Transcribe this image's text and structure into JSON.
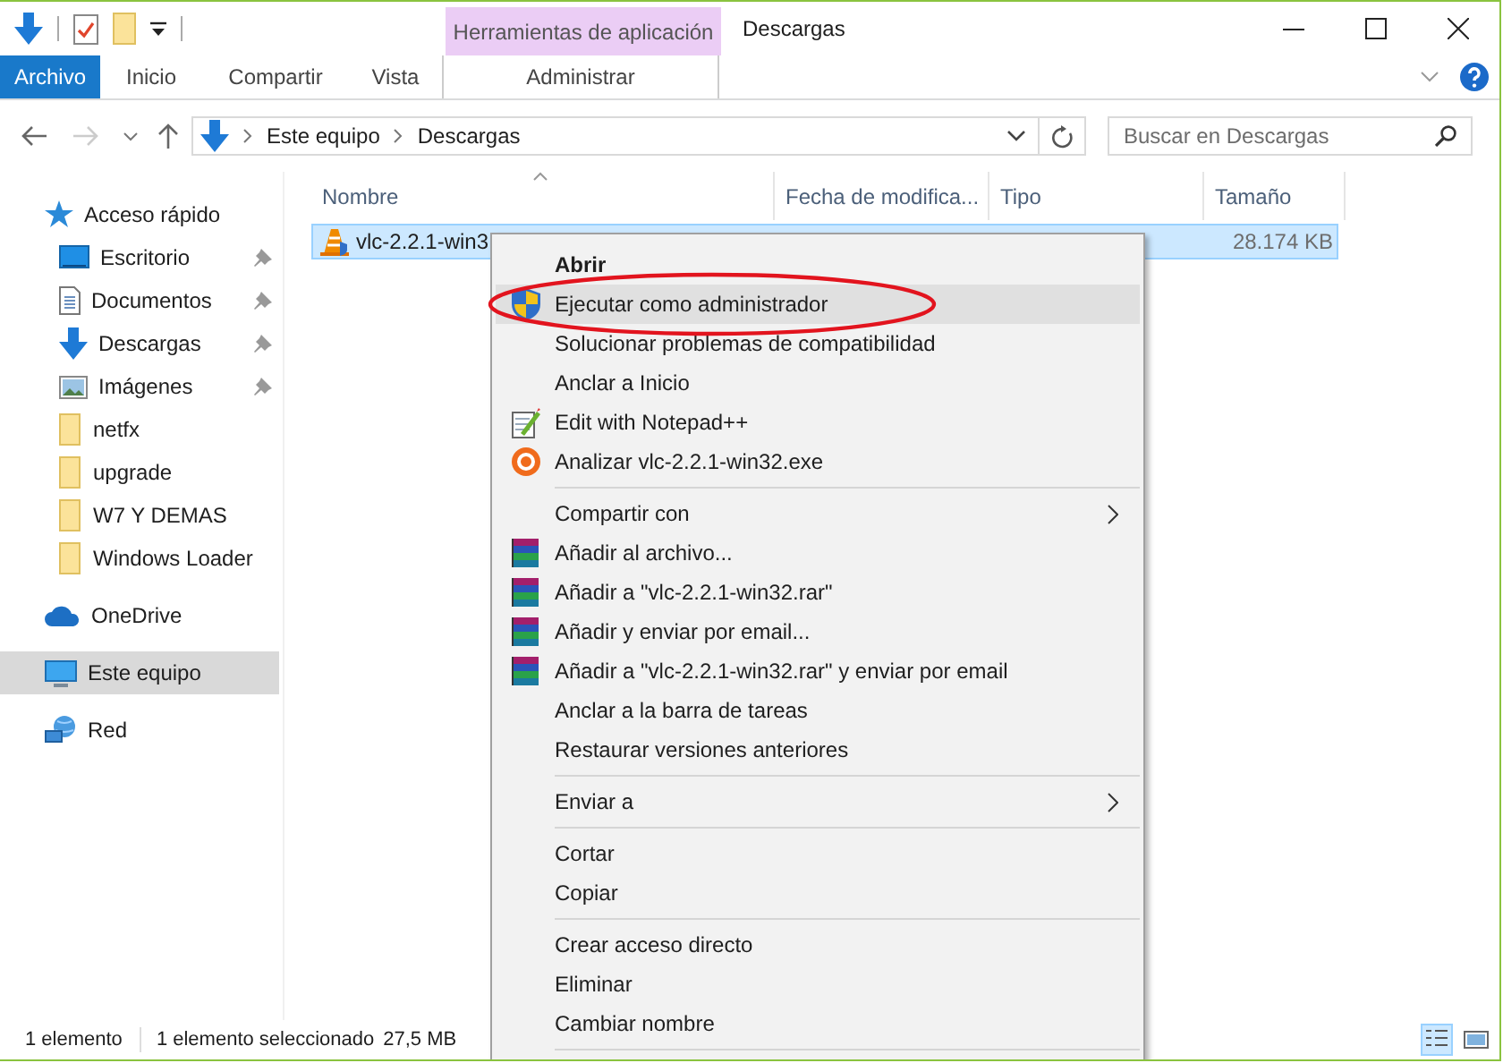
{
  "window": {
    "title": "Descargas",
    "context_tab_group": "Herramientas de aplicación"
  },
  "ribbon_tabs": [
    {
      "label": "Archivo",
      "kind": "file"
    },
    {
      "label": "Inicio",
      "kind": "tab"
    },
    {
      "label": "Compartir",
      "kind": "tab"
    },
    {
      "label": "Vista",
      "kind": "tab"
    },
    {
      "label": "Administrar",
      "kind": "context"
    }
  ],
  "address_bar": {
    "path": [
      "Este equipo",
      "Descargas"
    ]
  },
  "search": {
    "placeholder": "Buscar en Descargas"
  },
  "navigation": [
    {
      "label": "Acceso rápido",
      "kind": "star",
      "selected": false,
      "children": [
        {
          "label": "Escritorio",
          "kind": "desktop",
          "pinned": true,
          "selected": false
        },
        {
          "label": "Documentos",
          "kind": "documents",
          "pinned": true,
          "selected": false
        },
        {
          "label": "Descargas",
          "kind": "downloads",
          "pinned": true,
          "selected": false
        },
        {
          "label": "Imágenes",
          "kind": "pictures",
          "pinned": true,
          "selected": false
        },
        {
          "label": "netfx",
          "kind": "folder",
          "pinned": false,
          "selected": false
        },
        {
          "label": "upgrade",
          "kind": "folder",
          "pinned": false,
          "selected": false
        },
        {
          "label": "W7 Y DEMAS",
          "kind": "folder",
          "pinned": false,
          "selected": false
        },
        {
          "label": "Windows Loader",
          "kind": "folder",
          "pinned": false,
          "selected": false
        }
      ]
    },
    {
      "label": "OneDrive",
      "kind": "cloud",
      "selected": false
    },
    {
      "label": "Este equipo",
      "kind": "computer",
      "selected": true
    },
    {
      "label": "Red",
      "kind": "network",
      "selected": false
    }
  ],
  "columns": [
    {
      "label": "Nombre",
      "sorted": true
    },
    {
      "label": "Fecha de modifica...",
      "sorted": false
    },
    {
      "label": "Tipo",
      "sorted": false
    },
    {
      "label": "Tamaño",
      "sorted": false
    }
  ],
  "files": [
    {
      "name": "vlc-2.2.1-win3",
      "size": "28.174 KB",
      "selected": true
    }
  ],
  "context_menu": [
    {
      "kind": "plain",
      "label": "Abrir",
      "default": true,
      "hovered": false,
      "circled": false,
      "submenu": false
    },
    {
      "kind": "shield",
      "label": "Ejecutar como administrador",
      "default": false,
      "hovered": true,
      "circled": true,
      "submenu": false
    },
    {
      "kind": "plain",
      "label": "Solucionar problemas de compatibilidad",
      "default": false,
      "hovered": false,
      "circled": false,
      "submenu": false
    },
    {
      "kind": "plain",
      "label": "Anclar a Inicio",
      "default": false,
      "hovered": false,
      "circled": false,
      "submenu": false
    },
    {
      "kind": "notepad",
      "label": "Edit with Notepad++",
      "default": false,
      "hovered": false,
      "circled": false,
      "submenu": false
    },
    {
      "kind": "scan",
      "label": "Analizar vlc-2.2.1-win32.exe",
      "default": false,
      "hovered": false,
      "circled": false,
      "submenu": false
    },
    {
      "kind": "separator"
    },
    {
      "kind": "plain",
      "label": "Compartir con",
      "default": false,
      "hovered": false,
      "circled": false,
      "submenu": true
    },
    {
      "kind": "archive",
      "label": "Añadir al archivo...",
      "default": false,
      "hovered": false,
      "circled": false,
      "submenu": false
    },
    {
      "kind": "archive",
      "label": "Añadir a \"vlc-2.2.1-win32.rar\"",
      "default": false,
      "hovered": false,
      "circled": false,
      "submenu": false
    },
    {
      "kind": "archive",
      "label": "Añadir y enviar por email...",
      "default": false,
      "hovered": false,
      "circled": false,
      "submenu": false
    },
    {
      "kind": "archive",
      "label": "Añadir a \"vlc-2.2.1-win32.rar\" y enviar por email",
      "default": false,
      "hovered": false,
      "circled": false,
      "submenu": false
    },
    {
      "kind": "plain",
      "label": "Anclar a la barra de tareas",
      "default": false,
      "hovered": false,
      "circled": false,
      "submenu": false
    },
    {
      "kind": "plain",
      "label": "Restaurar versiones anteriores",
      "default": false,
      "hovered": false,
      "circled": false,
      "submenu": false
    },
    {
      "kind": "separator"
    },
    {
      "kind": "plain",
      "label": "Enviar a",
      "default": false,
      "hovered": false,
      "circled": false,
      "submenu": true
    },
    {
      "kind": "separator"
    },
    {
      "kind": "plain",
      "label": "Cortar",
      "default": false,
      "hovered": false,
      "circled": false,
      "submenu": false
    },
    {
      "kind": "plain",
      "label": "Copiar",
      "default": false,
      "hovered": false,
      "circled": false,
      "submenu": false
    },
    {
      "kind": "separator"
    },
    {
      "kind": "plain",
      "label": "Crear acceso directo",
      "default": false,
      "hovered": false,
      "circled": false,
      "submenu": false
    },
    {
      "kind": "plain",
      "label": "Eliminar",
      "default": false,
      "hovered": false,
      "circled": false,
      "submenu": false
    },
    {
      "kind": "plain",
      "label": "Cambiar nombre",
      "default": false,
      "hovered": false,
      "circled": false,
      "submenu": false
    },
    {
      "kind": "separator"
    }
  ],
  "status_bar": {
    "item_count": "1 elemento",
    "selection": "1 elemento seleccionado",
    "size": "27,5 MB"
  },
  "view_buttons": [
    {
      "kind": "details",
      "selected": true
    },
    {
      "kind": "tiles",
      "selected": false
    }
  ]
}
